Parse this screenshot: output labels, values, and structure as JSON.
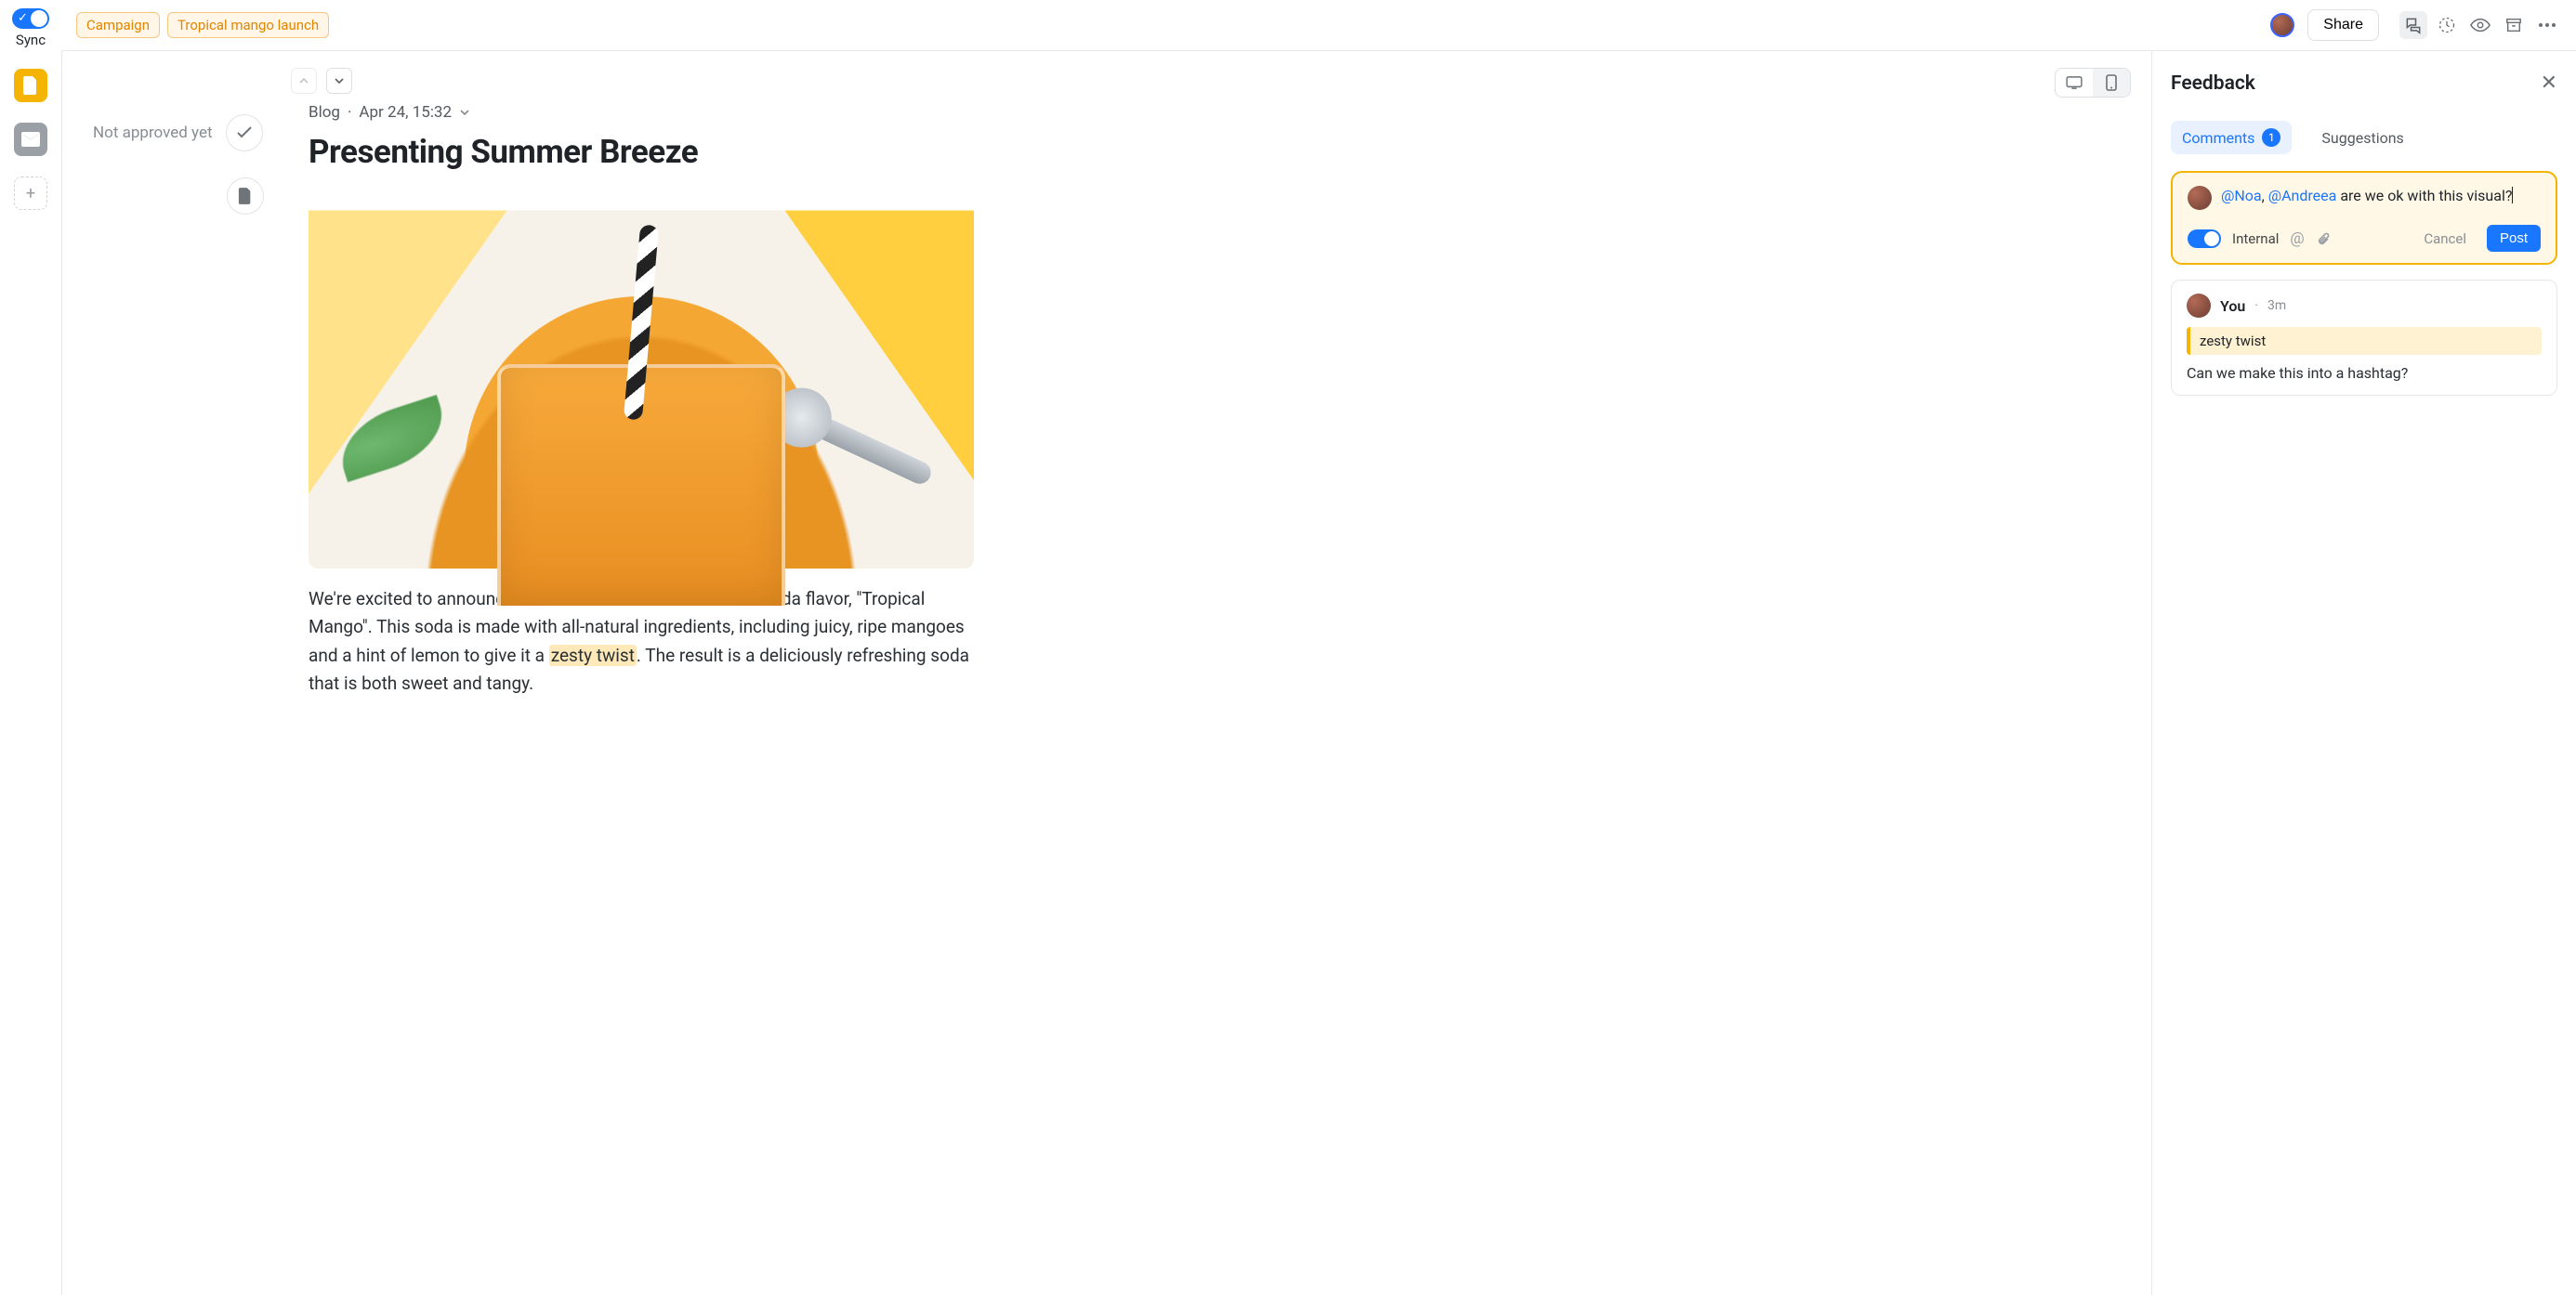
{
  "rail": {
    "sync_label": "Sync",
    "add_glyph": "+"
  },
  "topbar": {
    "tags": [
      "Campaign",
      "Tropical mango launch"
    ],
    "share_label": "Share"
  },
  "canvas": {
    "status": "Not approved yet",
    "meta_type": "Blog",
    "meta_sep": "·",
    "meta_time": "Apr 24, 15:32",
    "title": "Presenting Summer Breeze",
    "body_before_hl": "We're excited to announce the launch of our latest natural soda flavor, \"Tropical Mango\". This soda is made with all-natural ingredients, including juicy, ripe mangoes and a hint of lemon to give it a ",
    "body_hl": "zesty twist",
    "body_after_hl": ". The result is a deliciously refreshing soda that is both sweet and tangy."
  },
  "panel": {
    "title": "Feedback",
    "tabs": {
      "comments": "Comments",
      "comments_count": "1",
      "suggestions": "Suggestions"
    },
    "composer": {
      "mention1": "@Noa",
      "sep": ", ",
      "mention2": "@Andreea",
      "rest": " are we ok with this visual?",
      "internal_label": "Internal",
      "cancel": "Cancel",
      "post": "Post"
    },
    "comment1": {
      "author": "You",
      "time_sep": "·",
      "time": "3m",
      "quote": "zesty twist",
      "body": "Can we make this into a hashtag?"
    }
  }
}
